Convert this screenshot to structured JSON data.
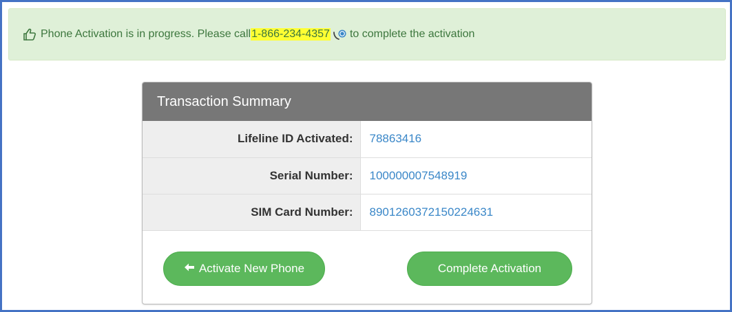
{
  "alert": {
    "prefix": "Phone Activation is in progress. Please call ",
    "phone_number": "1-866-234-4357",
    "suffix": " to complete the activation",
    "color": "#3c763d",
    "background": "#dff0d8",
    "highlight": "#ffff33",
    "icon": "thumbs-up-icon",
    "call_icon": "phone-call-icon"
  },
  "panel": {
    "title": "Transaction Summary",
    "rows": [
      {
        "label": "Lifeline ID Activated:",
        "value": "78863416"
      },
      {
        "label": "Serial Number:",
        "value": "100000007548919"
      },
      {
        "label": "SIM Card Number:",
        "value": "8901260372150224631"
      }
    ]
  },
  "actions": {
    "back_label": "Activate New Phone",
    "back_icon": "arrow-left-icon",
    "complete_label": "Complete Activation",
    "button_color": "#5cb85c"
  },
  "frame_color": "#4472c4"
}
